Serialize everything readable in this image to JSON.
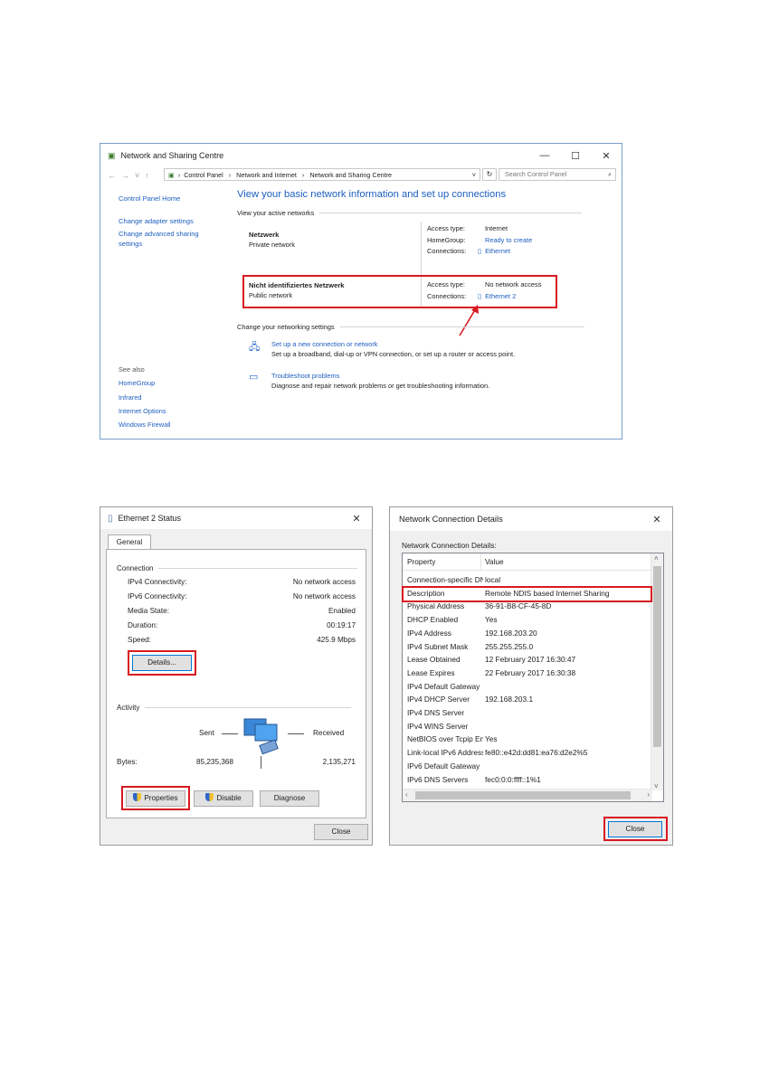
{
  "nsc": {
    "title": "Network and Sharing Centre",
    "breadcrumbs": [
      "Control Panel",
      "›",
      "Network and Internet",
      "›",
      "Network and Sharing Centre"
    ],
    "search_placeholder": "Search Control Panel",
    "left_links": [
      "Control Panel Home",
      "Change adapter settings",
      "Change advanced sharing settings"
    ],
    "see_also_label": "See also",
    "see_also_links": [
      "HomeGroup",
      "Infrared",
      "Internet Options",
      "Windows Firewall"
    ],
    "main_title": "View your basic network information and set up connections",
    "active_networks_label": "View your active networks",
    "networks": [
      {
        "name": "Netzwerk",
        "type": "Private network",
        "access_type_label": "Access type:",
        "access_type": "Internet",
        "homegroup_label": "HomeGroup:",
        "homegroup": "Ready to create",
        "connections_label": "Connections:",
        "connection": "Ethernet"
      },
      {
        "name": "Nicht identifiziertes Netzwerk",
        "type": "Public network",
        "access_type_label": "Access type:",
        "access_type": "No network access",
        "connections_label": "Connections:",
        "connection": "Ethernet 2"
      }
    ],
    "change_settings_label": "Change your networking settings",
    "tasks": [
      {
        "link": "Set up a new connection or network",
        "desc": "Set up a broadband, dial-up or VPN connection, or set up a router or access point."
      },
      {
        "link": "Troubleshoot problems",
        "desc": "Diagnose and repair network problems or get troubleshooting information."
      }
    ]
  },
  "status": {
    "title": "Ethernet 2 Status",
    "tab": "General",
    "connection_label": "Connection",
    "rows": [
      {
        "label": "IPv4 Connectivity:",
        "value": "No network access"
      },
      {
        "label": "IPv6 Connectivity:",
        "value": "No network access"
      },
      {
        "label": "Media State:",
        "value": "Enabled"
      },
      {
        "label": "Duration:",
        "value": "00:19:17"
      },
      {
        "label": "Speed:",
        "value": "425.9 Mbps"
      }
    ],
    "details_button": "Details...",
    "activity_label": "Activity",
    "sent_label": "Sent",
    "received_label": "Received",
    "bytes_label": "Bytes:",
    "bytes_sent": "85,235,368",
    "bytes_received": "2,135,271",
    "properties_button": "Properties",
    "disable_button": "Disable",
    "diagnose_button": "Diagnose",
    "close_button": "Close"
  },
  "details": {
    "title": "Network Connection Details",
    "label": "Network Connection Details:",
    "col_property": "Property",
    "col_value": "Value",
    "rows": [
      {
        "p": "Connection-specific DN...",
        "v": "local"
      },
      {
        "p": "Description",
        "v": "Remote NDIS based Internet Sharing"
      },
      {
        "p": "Physical Address",
        "v": "36-91-B8-CF-45-8D"
      },
      {
        "p": "DHCP Enabled",
        "v": "Yes"
      },
      {
        "p": "IPv4 Address",
        "v": "192.168.203.20"
      },
      {
        "p": "IPv4 Subnet Mask",
        "v": "255.255.255.0"
      },
      {
        "p": "Lease Obtained",
        "v": "12 February 2017 16:30:47"
      },
      {
        "p": "Lease Expires",
        "v": "22 February 2017 16:30:38"
      },
      {
        "p": "IPv4 Default Gateway",
        "v": ""
      },
      {
        "p": "IPv4 DHCP Server",
        "v": "192.168.203.1"
      },
      {
        "p": "IPv4 DNS Server",
        "v": ""
      },
      {
        "p": "IPv4 WINS Server",
        "v": ""
      },
      {
        "p": "NetBIOS over Tcpip En...",
        "v": "Yes"
      },
      {
        "p": "Link-local IPv6 Address",
        "v": "fe80::e42d:dd81:ea76:d2e2%5"
      },
      {
        "p": "IPv6 Default Gateway",
        "v": ""
      },
      {
        "p": "IPv6 DNS Servers",
        "v": "fec0:0:0:ffff::1%1"
      }
    ],
    "close_button": "Close"
  },
  "colors": {
    "highlight_red": "#d71920",
    "link_blue": "#1e5fbf"
  }
}
